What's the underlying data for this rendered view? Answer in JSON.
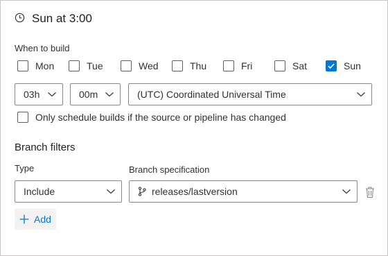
{
  "schedule": {
    "title": "Sun at 3:00",
    "when_to_build_label": "When to build",
    "days": [
      {
        "label": "Mon",
        "checked": false
      },
      {
        "label": "Tue",
        "checked": false
      },
      {
        "label": "Wed",
        "checked": false
      },
      {
        "label": "Thu",
        "checked": false
      },
      {
        "label": "Fri",
        "checked": false
      },
      {
        "label": "Sat",
        "checked": false
      },
      {
        "label": "Sun",
        "checked": true
      }
    ],
    "hour": "03h",
    "minute": "00m",
    "timezone": "(UTC) Coordinated Universal Time",
    "only_if_changed": {
      "label": "Only schedule builds if the source or pipeline has changed",
      "checked": false
    }
  },
  "branch_filters": {
    "title": "Branch filters",
    "type_label": "Type",
    "spec_label": "Branch specification",
    "type_value": "Include",
    "spec_value": "releases/lastversion",
    "add_label": "Add"
  },
  "colors": {
    "accent": "#0078d4",
    "border": "#8a8886",
    "text": "#323130"
  },
  "icons": {
    "clock": "clock-icon",
    "chevron": "chevron-down-icon",
    "branch": "branch-icon",
    "delete": "trash-icon",
    "add": "plus-icon",
    "check": "checkmark-icon"
  }
}
